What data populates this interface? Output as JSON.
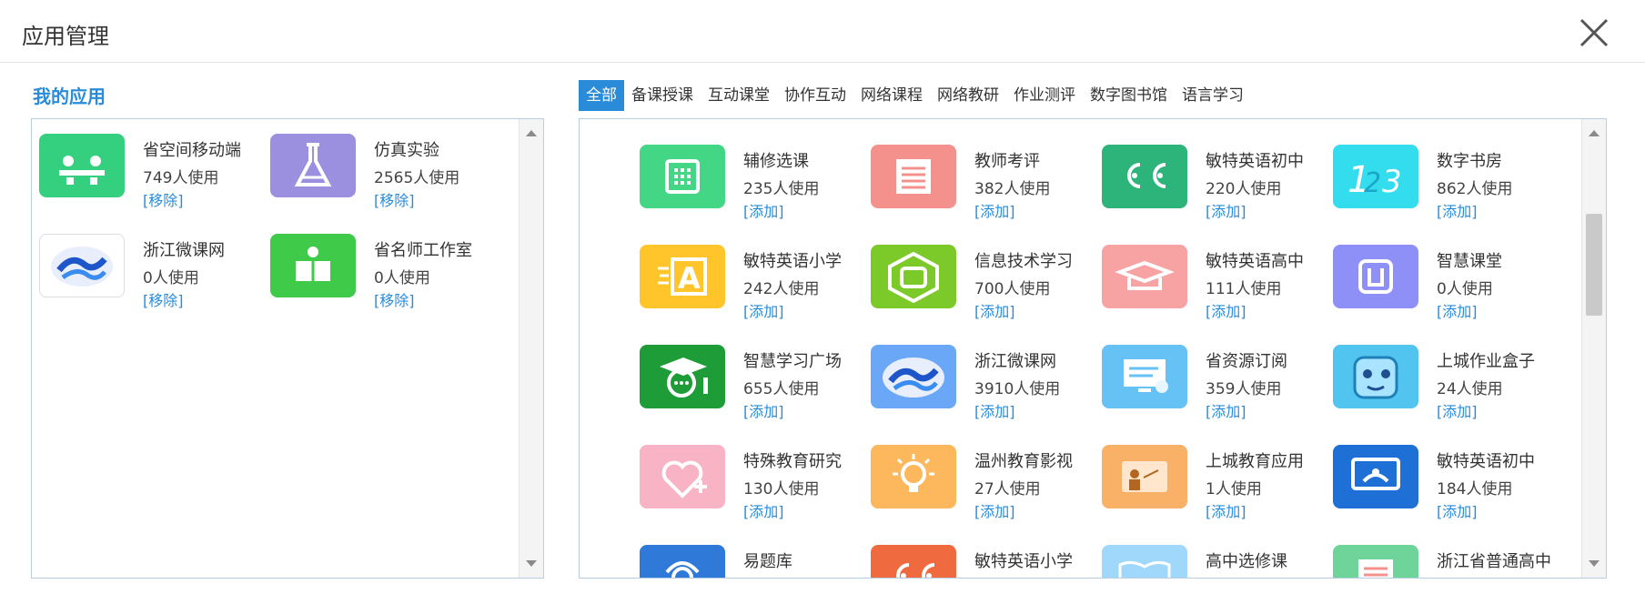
{
  "dialog": {
    "title": "应用管理"
  },
  "my_apps": {
    "title": "我的应用",
    "items": [
      {
        "name": "省空间移动端",
        "users": "749人使用",
        "action": "[移除]",
        "icon": "meeting-people-icon",
        "color": "#35d07f"
      },
      {
        "name": "仿真实验",
        "users": "2565人使用",
        "action": "[移除]",
        "icon": "flask-icon",
        "color": "#9b8fe0"
      },
      {
        "name": "浙江微课网",
        "users": "0人使用",
        "action": "[移除]",
        "icon": "wave-logo-icon",
        "color": "#ffffff"
      },
      {
        "name": "省名师工作室",
        "users": "0人使用",
        "action": "[移除]",
        "icon": "book-person-icon",
        "color": "#3fca49"
      }
    ]
  },
  "tabs": [
    "全部",
    "备课授课",
    "互动课堂",
    "协作互动",
    "网络课程",
    "网络教研",
    "作业测评",
    "数字图书馆",
    "语言学习"
  ],
  "active_tab": "全部",
  "store_apps": [
    {
      "name": "辅修选课",
      "users": "235人使用",
      "action": "[添加]",
      "icon": "grid-icon",
      "color": "#43d685"
    },
    {
      "name": "教师考评",
      "users": "382人使用",
      "action": "[添加]",
      "icon": "document-lines-icon",
      "color": "#f4918c"
    },
    {
      "name": "敏特英语初中",
      "users": "220人使用",
      "action": "[添加]",
      "icon": "cc-letters-icon",
      "color": "#2db47b"
    },
    {
      "name": "数字书房",
      "users": "862人使用",
      "action": "[添加]",
      "icon": "numbers-123-icon",
      "color": "#33ddee"
    },
    {
      "name": "敏特英语小学",
      "users": "242人使用",
      "action": "[添加]",
      "icon": "letter-a-icon",
      "color": "#ffc52a"
    },
    {
      "name": "信息技术学习",
      "users": "700人使用",
      "action": "[添加]",
      "icon": "hexagon-screen-icon",
      "color": "#7cc92a"
    },
    {
      "name": "敏特英语高中",
      "users": "111人使用",
      "action": "[添加]",
      "icon": "graduation-cap-icon",
      "color": "#f7a3a3"
    },
    {
      "name": "智慧课堂",
      "users": "0人使用",
      "action": "[添加]",
      "icon": "square-logo-icon",
      "color": "#8e8ff7"
    },
    {
      "name": "智慧学习广场",
      "users": "655人使用",
      "action": "[添加]",
      "icon": "chat-graduate-icon",
      "color": "#1d9c37"
    },
    {
      "name": "浙江微课网",
      "users": "3910人使用",
      "action": "[添加]",
      "icon": "wave-logo-icon",
      "color": "#6aa8f7"
    },
    {
      "name": "省资源订阅",
      "users": "359人使用",
      "action": "[添加]",
      "icon": "monitor-check-icon",
      "color": "#66c2f5"
    },
    {
      "name": "上城作业盒子",
      "users": "24人使用",
      "action": "[添加]",
      "icon": "box-face-icon",
      "color": "#52c4f0"
    },
    {
      "name": "特殊教育研究",
      "users": "130人使用",
      "action": "[添加]",
      "icon": "heart-plus-icon",
      "color": "#f8b3c4"
    },
    {
      "name": "温州教育影视",
      "users": "27人使用",
      "action": "[添加]",
      "icon": "lightbulb-icon",
      "color": "#fdb85e"
    },
    {
      "name": "上城教育应用",
      "users": "1人使用",
      "action": "[添加]",
      "icon": "teacher-board-icon",
      "color": "#f9b067"
    },
    {
      "name": "敏特英语初中",
      "users": "184人使用",
      "action": "[添加]",
      "icon": "presentation-screen-icon",
      "color": "#1f70d6"
    },
    {
      "name": "易题库",
      "users": "",
      "action": "",
      "icon": "question-bank-icon",
      "color": "#2f79d9"
    },
    {
      "name": "敏特英语小学",
      "users": "",
      "action": "",
      "icon": "cc-letters-icon",
      "color": "#f06a3f"
    },
    {
      "name": "高中选修课",
      "users": "",
      "action": "",
      "icon": "open-book-icon",
      "color": "#9fd8fb"
    },
    {
      "name": "浙江省普通高中",
      "users": "",
      "action": "",
      "icon": "document-lines-icon",
      "color": "#6ed49a"
    }
  ]
}
